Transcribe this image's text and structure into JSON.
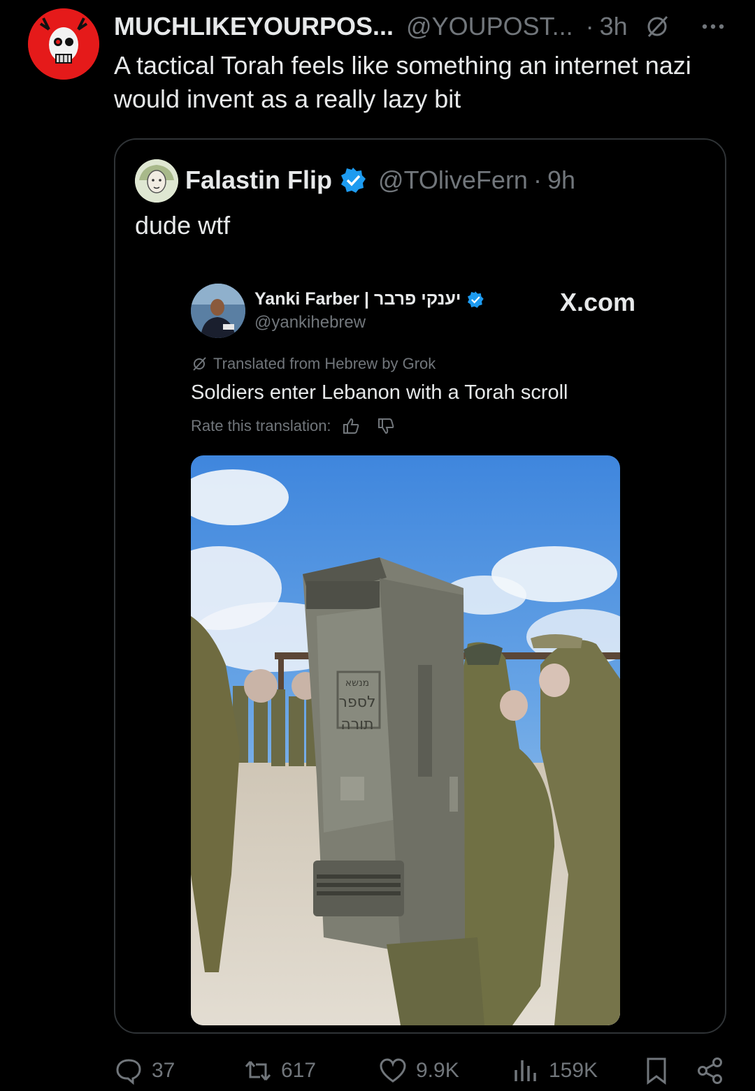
{
  "tweet": {
    "display_name": "MUCHLIKEYOURPOS...",
    "handle": "@YOUPOST...",
    "separator": "·",
    "time": "3h",
    "text": "A tactical Torah feels like something an internet nazi would invent as a really lazy bit"
  },
  "quote": {
    "display_name": "Falastin Flip",
    "handle": "@TOliveFern",
    "separator": "·",
    "time": "9h",
    "text": "dude wtf",
    "embedded": {
      "name": "Yanki Farber | יענקי פרבר",
      "handle": "@yankihebrew",
      "brand": "X.com",
      "translated_label": "Translated from Hebrew by Grok",
      "body": "Soldiers enter Lebanon with a Torah scroll",
      "rate_label": "Rate this translation:"
    }
  },
  "actions": {
    "replies": "37",
    "reposts": "617",
    "likes": "9.9K",
    "views": "159K"
  },
  "colors": {
    "background": "#000000",
    "text": "#e7e9ea",
    "muted": "#71767b",
    "border": "#2f3336",
    "verified": "#1d9bf0",
    "avatar_red": "#e51a1a"
  }
}
